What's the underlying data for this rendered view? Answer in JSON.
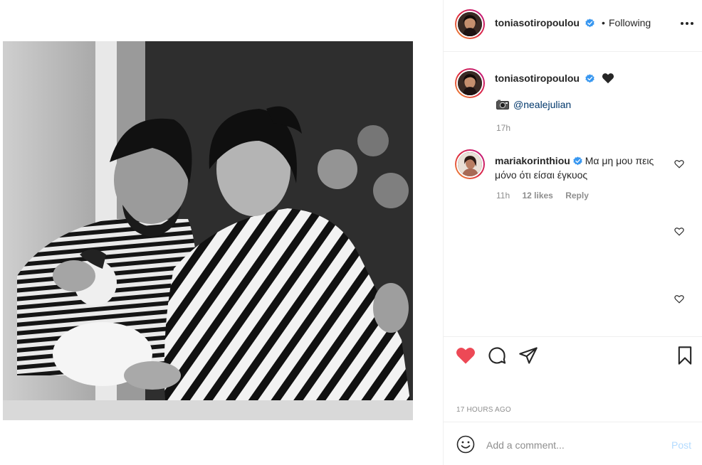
{
  "post": {
    "author": "toniasotiropoulou",
    "follow_dot": "•",
    "follow_status": "Following",
    "caption_mention": "@nealejulian",
    "caption_time": "17h",
    "timestamp": "17 HOURS AGO",
    "liked": true
  },
  "comments": [
    {
      "username": "mariakorinthiou",
      "text": "Μα μη μου πεις μόνο ότι είσαι έγκυος",
      "time": "11h",
      "likes": "12 likes",
      "reply": "Reply"
    }
  ],
  "composer": {
    "placeholder": "Add a comment...",
    "post_label": "Post"
  },
  "icons": {
    "verified": "verified-badge-icon",
    "more": "more-options-icon",
    "heart": "heart-icon",
    "comment": "comment-icon",
    "share": "share-icon",
    "save": "bookmark-icon",
    "emoji": "emoji-icon",
    "camera": "camera-emoji-icon",
    "black_heart": "black-heart-emoji-icon"
  },
  "colors": {
    "like_red": "#ed4956",
    "verified_blue": "#3897f0",
    "link_blue": "#00376b",
    "muted_text": "#8e8e8e",
    "post_disabled": "#b3dbff"
  }
}
